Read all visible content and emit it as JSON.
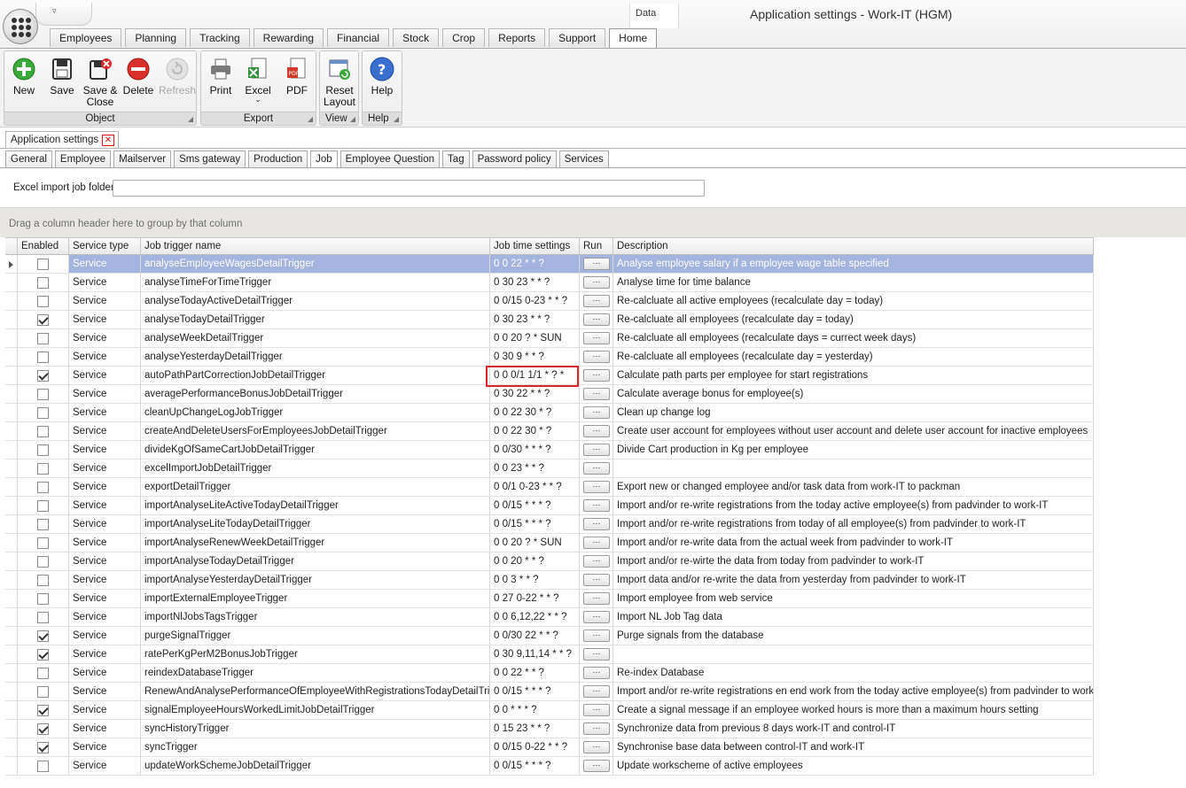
{
  "app": {
    "title": "Application settings - Work-IT (HGM)",
    "context_tab": "Data",
    "qat_glyph": "▿"
  },
  "main_tabs": [
    "Employees",
    "Planning",
    "Tracking",
    "Rewarding",
    "Financial",
    "Stock",
    "Crop",
    "Reports",
    "Support",
    "Home"
  ],
  "active_main_tab": "Home",
  "ribbon": {
    "groups": [
      {
        "label": "Object",
        "buttons": [
          {
            "label": "New",
            "icon": "add-icon"
          },
          {
            "label": "Save",
            "icon": "save-icon"
          },
          {
            "label": "Save & Close",
            "icon": "save-close-icon"
          },
          {
            "label": "Delete",
            "icon": "delete-icon"
          },
          {
            "label": "Refresh",
            "icon": "refresh-icon",
            "disabled": true
          }
        ]
      },
      {
        "label": "Export",
        "buttons": [
          {
            "label": "Print",
            "icon": "print-icon"
          },
          {
            "label": "Excel",
            "icon": "excel-icon"
          },
          {
            "label": "PDF",
            "icon": "pdf-icon"
          }
        ]
      },
      {
        "label": "View",
        "buttons": [
          {
            "label": "Reset Layout",
            "icon": "reset-layout-icon"
          }
        ]
      },
      {
        "label": "Help",
        "buttons": [
          {
            "label": "Help",
            "icon": "help-icon"
          }
        ]
      }
    ]
  },
  "document_tab": "Application settings",
  "settings_tabs": [
    "General",
    "Employee",
    "Mailserver",
    "Sms gateway",
    "Production",
    "Job",
    "Employee Question",
    "Tag",
    "Password policy",
    "Services"
  ],
  "active_settings_tab": "Job",
  "excel_import": {
    "label": "Excel import job folder",
    "value": ""
  },
  "group_panel_text": "Drag a column header here to group by that column",
  "grid": {
    "columns": [
      "Enabled",
      "Service type",
      "Job trigger name",
      "Job time settings",
      "Run",
      "Description"
    ],
    "run_label": "···",
    "rows": [
      {
        "enabled": false,
        "type": "Service",
        "name": "analyseEmployeeWagesDetailTrigger",
        "time": "0 0 22 * * ?",
        "desc": "Analyse employee salary if a employee wage table specified"
      },
      {
        "enabled": false,
        "type": "Service",
        "name": "analyseTimeForTimeTrigger",
        "time": "0 30 23 * * ?",
        "desc": "Analyse time for time balance"
      },
      {
        "enabled": false,
        "type": "Service",
        "name": "analyseTodayActiveDetailTrigger",
        "time": "0 0/15 0-23 * * ?",
        "desc": "Re-calcluate all active employees (recalculate day = today)"
      },
      {
        "enabled": true,
        "type": "Service",
        "name": "analyseTodayDetailTrigger",
        "time": "0 30 23 * * ?",
        "desc": "Re-calcluate all employees (recalculate day = today)"
      },
      {
        "enabled": false,
        "type": "Service",
        "name": "analyseWeekDetailTrigger",
        "time": "0 0 20 ? * SUN",
        "desc": "Re-calcluate all employees (recalculate days = currect week days)"
      },
      {
        "enabled": false,
        "type": "Service",
        "name": "analyseYesterdayDetailTrigger",
        "time": "0 30 9 * * ?",
        "desc": "Re-calcluate all employees (recalculate day = yesterday)"
      },
      {
        "enabled": true,
        "type": "Service",
        "name": "autoPathPartCorrectionJobDetailTrigger",
        "time": "0 0 0/1 1/1 * ? *",
        "desc": "Calculate path parts per employee for start registrations"
      },
      {
        "enabled": false,
        "type": "Service",
        "name": "averagePerformanceBonusJobDetailTrigger",
        "time": "0 30 22 * * ?",
        "desc": "Calculate average bonus for employee(s)"
      },
      {
        "enabled": false,
        "type": "Service",
        "name": "cleanUpChangeLogJobTrigger",
        "time": "0 0 22 30 * ?",
        "desc": "Clean up change log"
      },
      {
        "enabled": false,
        "type": "Service",
        "name": "createAndDeleteUsersForEmployeesJobDetailTrigger",
        "time": "0 0 22 30 * ?",
        "desc": "Create user account for employees without user account and delete user account for inactive employees"
      },
      {
        "enabled": false,
        "type": "Service",
        "name": "divideKgOfSameCartJobDetailTrigger",
        "time": "0 0/30 * * * ?",
        "desc": "Divide Cart production in Kg per employee"
      },
      {
        "enabled": false,
        "type": "Service",
        "name": "excelImportJobDetailTrigger",
        "time": "0 0 23 * * ?",
        "desc": ""
      },
      {
        "enabled": false,
        "type": "Service",
        "name": "exportDetailTrigger",
        "time": "0 0/1 0-23 * * ?",
        "desc": "Export new or changed employee and/or task data from work-IT to packman"
      },
      {
        "enabled": false,
        "type": "Service",
        "name": "importAnalyseLiteActiveTodayDetailTrigger",
        "time": "0 0/15 * * * ?",
        "desc": "Import and/or re-write registrations from the today active employee(s) from padvinder to work-IT"
      },
      {
        "enabled": false,
        "type": "Service",
        "name": "importAnalyseLiteTodayDetailTrigger",
        "time": "0 0/15 * * * ?",
        "desc": "Import and/or re-write registrations from today of all employee(s) from padvinder to work-IT"
      },
      {
        "enabled": false,
        "type": "Service",
        "name": "importAnalyseRenewWeekDetailTrigger",
        "time": "0 0 20 ? * SUN",
        "desc": "Import and/or re-write data from the actual week from padvinder to work-IT"
      },
      {
        "enabled": false,
        "type": "Service",
        "name": "importAnalyseTodayDetailTrigger",
        "time": "0 0 20 * * ?",
        "desc": "Import and/or re-wirte the data from today from padvinder to work-IT"
      },
      {
        "enabled": false,
        "type": "Service",
        "name": "importAnalyseYesterdayDetailTrigger",
        "time": "0 0 3 * * ?",
        "desc": "Import data and/or re-write the data from yesterday from padvinder to work-IT"
      },
      {
        "enabled": false,
        "type": "Service",
        "name": "importExternalEmployeeTrigger",
        "time": "0 27 0-22 * * ?",
        "desc": "Import employee from web service"
      },
      {
        "enabled": false,
        "type": "Service",
        "name": "importNlJobsTagsTrigger",
        "time": "0 0 6,12,22 * * ?",
        "desc": "Import NL Job Tag data"
      },
      {
        "enabled": true,
        "type": "Service",
        "name": "purgeSignalTrigger",
        "time": "0 0/30 22 * * ?",
        "desc": "Purge signals from the database"
      },
      {
        "enabled": true,
        "type": "Service",
        "name": "ratePerKgPerM2BonusJobTrigger",
        "time": "0 30 9,11,14 * * ?",
        "desc": ""
      },
      {
        "enabled": false,
        "type": "Service",
        "name": "reindexDatabaseTrigger",
        "time": "0 0 22 * * ?",
        "desc": "Re-index Database"
      },
      {
        "enabled": false,
        "type": "Service",
        "name": "RenewAndAnalysePerformanceOfEmployeeWithRegistrationsTodayDetailTrigger",
        "time": "0 0/15 * * * ?",
        "desc": "Import and/or re-write registrations en end work from the today active employee(s) from padvinder to work-IT"
      },
      {
        "enabled": true,
        "type": "Service",
        "name": "signalEmployeeHoursWorkedLimitJobDetailTrigger",
        "time": "0 0 * * * ?",
        "desc": "Create a signal message if an employee worked hours is more than a maximum hours setting"
      },
      {
        "enabled": true,
        "type": "Service",
        "name": "syncHistoryTrigger",
        "time": "0 15 23 * * ?",
        "desc": "Synchronize data from previous 8 days work-IT and control-IT"
      },
      {
        "enabled": true,
        "type": "Service",
        "name": "syncTrigger",
        "time": "0 0/15 0-22 * * ?",
        "desc": "Synchronise base data between control-IT and work-IT"
      },
      {
        "enabled": false,
        "type": "Service",
        "name": "updateWorkSchemeJobDetailTrigger",
        "time": "0 0/15 * * * ?",
        "desc": "Update workscheme of active employees"
      }
    ]
  },
  "colors": {
    "selected_row": "#a3b4df",
    "highlight_box": "#d9262b"
  }
}
